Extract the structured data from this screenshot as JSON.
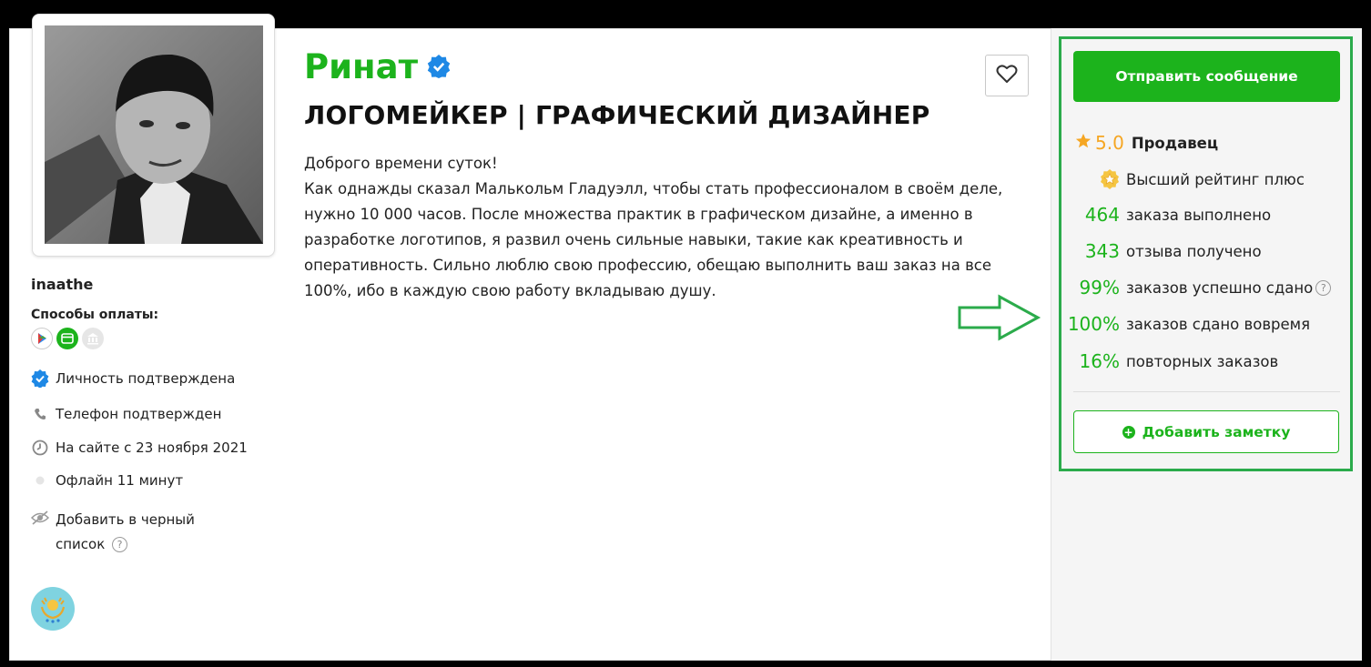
{
  "profile": {
    "name": "Ринат",
    "job_title": "ЛОГОМЕЙКЕР | ГРАФИЧЕСКИЙ ДИЗАЙНЕР",
    "bio": [
      "Доброго времени суток!",
      "Как однажды сказал Малькольм Гладуэлл, чтобы стать профессионалом в своём деле, нужно 10 000 часов. После множества практик в графическом дизайне, а именно в разработке логотипов, я развил очень сильные навыки, такие как креативность и оперативность. Сильно люблю свою профессию, обещаю выполнить ваш заказ на все 100%, ибо в каждую свою работу вкладываю душу."
    ]
  },
  "sidebar": {
    "username": "inaathe",
    "payment_label": "Способы оплаты:",
    "payment_icons": [
      "play-icon",
      "card-icon",
      "bank-icon"
    ],
    "identity": "Личность подтверждена",
    "phone": "Телефон подтвержден",
    "joined": "На сайте с 23 ноября 2021",
    "status": "Офлайн 11 минут",
    "blacklist_line1": "Добавить в черный",
    "blacklist_line2": "список",
    "help_mark": "?"
  },
  "panel": {
    "send_message": "Отправить сообщение",
    "rating_value": "5.0",
    "rating_label": "Продавец",
    "top_rating": "Высший рейтинг плюс",
    "stats": [
      {
        "num": "464",
        "label": "заказа выполнено"
      },
      {
        "num": "343",
        "label": "отзыва получено"
      },
      {
        "num": "99%",
        "label": "заказов успешно сдано"
      },
      {
        "num": "100%",
        "label": "заказов сдано вовремя"
      },
      {
        "num": "16%",
        "label": "повторных заказов"
      }
    ],
    "add_note": "Добавить заметку",
    "plus": "+"
  },
  "colors": {
    "brand_green": "#1cb31c",
    "star_orange": "#f5a623",
    "verified_blue": "#1e88e5",
    "highlight_green": "#2bab4b"
  }
}
